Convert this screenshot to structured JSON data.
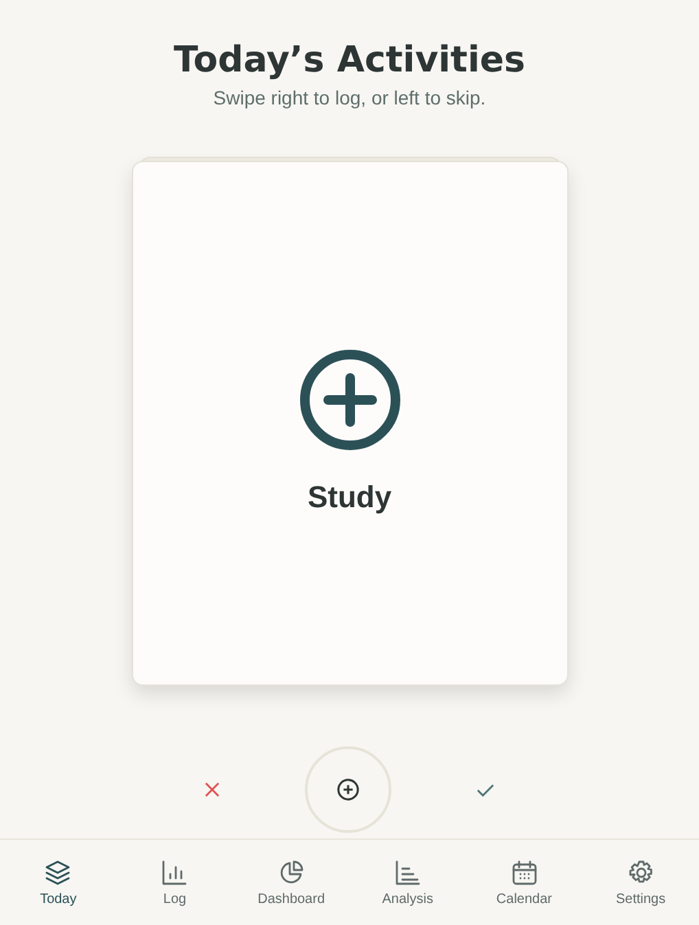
{
  "header": {
    "title": "Today’s Activities",
    "subtitle": "Swipe right to log, or left to skip."
  },
  "card": {
    "activity": "Study"
  },
  "nav": [
    {
      "label": "Today",
      "kind": "layers",
      "selected": true
    },
    {
      "label": "Log",
      "kind": "bars",
      "selected": false
    },
    {
      "label": "Dashboard",
      "kind": "pie",
      "selected": false
    },
    {
      "label": "Analysis",
      "kind": "chart",
      "selected": false
    },
    {
      "label": "Calendar",
      "kind": "calendar",
      "selected": false
    },
    {
      "label": "Settings",
      "kind": "gear",
      "selected": false
    }
  ]
}
